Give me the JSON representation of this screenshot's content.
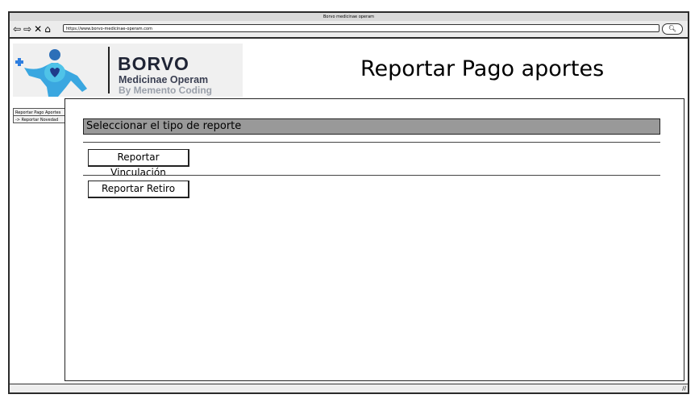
{
  "window": {
    "title": "Borvo medicinae operam",
    "url": "https://www.borvo-medicinae-operam.com"
  },
  "nav": {
    "back_icon": "arrow-left-icon",
    "forward_icon": "arrow-right-icon",
    "close_icon": "close-icon",
    "home_icon": "home-icon",
    "search_icon": "search-icon"
  },
  "logo": {
    "brand": "BORVO",
    "line1": "Medicinae Operam",
    "line2": "By Memento Coding",
    "brand_color": "#1f2435",
    "accent_color": "#2f7fe0"
  },
  "page": {
    "title": "Reportar Pago aportes"
  },
  "sidebar": {
    "items": [
      {
        "label": "Reportar Pago Aportes"
      },
      {
        "label": "-> Reportar Novedad"
      }
    ]
  },
  "main": {
    "section_label": "Seleccionar el tipo de reporte",
    "buttons": {
      "vinculacion": "Reportar Vinculación",
      "retiro": "Reportar Retiro"
    }
  }
}
